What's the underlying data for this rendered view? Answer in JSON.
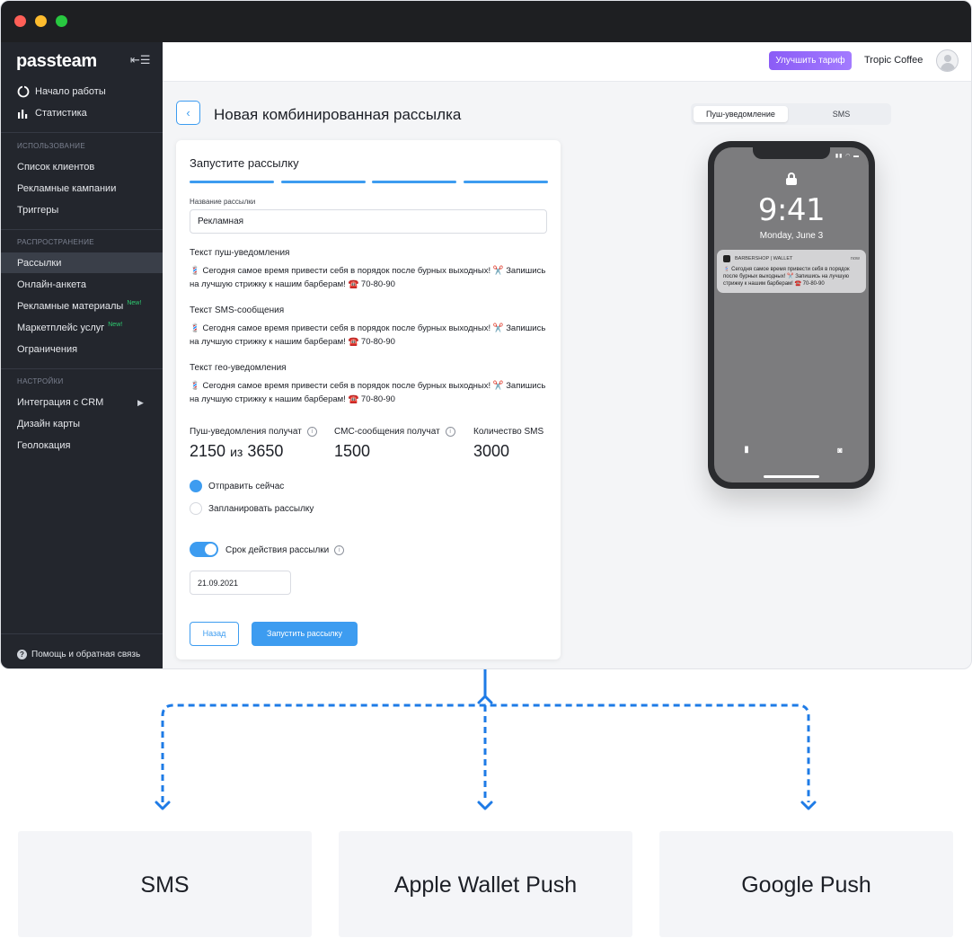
{
  "sidebar": {
    "logo": "passteam",
    "collapse_icon": "menu-collapse-icon",
    "top_items": [
      {
        "label": "Начало работы",
        "icon": "power-icon"
      },
      {
        "label": "Статистика",
        "icon": "bar-chart-icon"
      }
    ],
    "usage_section": "ИСПОЛЬЗОВАНИЕ",
    "usage_items": [
      "Список клиентов",
      "Рекламные кампании",
      "Триггеры"
    ],
    "distribution_section": "РАСПРОСТРАНЕНИЕ",
    "distribution_items": [
      {
        "label": "Рассылки",
        "active": true
      },
      {
        "label": "Онлайн-анкета"
      },
      {
        "label": "Рекламные материалы",
        "badge": "New!"
      },
      {
        "label": "Маркетплейс услуг",
        "badge": "New!"
      },
      {
        "label": "Ограничения"
      }
    ],
    "settings_section": "НАСТРОЙКИ",
    "settings_items": [
      "Интеграция с CRM",
      "Дизайн карты",
      "Геолокация"
    ],
    "help": "Помощь и обратная связь"
  },
  "topbar": {
    "upgrade_label": "Улучшить тариф",
    "company": "Tropic Coffee"
  },
  "page": {
    "title": "Новая комбинированная рассылка"
  },
  "form": {
    "card_title": "Запустите рассылку",
    "steps_total": 4,
    "name_label": "Название рассылки",
    "name_value": "Рекламная",
    "push_label": "Текст пуш-уведомления",
    "sms_label": "Текст SMS-сообщения",
    "geo_label": "Текст гео-уведомления",
    "message_text": "💈 Сегодня самое время привести себя в порядок после бурных выходных! ✂️ Запишись на лучшую стрижку к нашим барберам! ☎️ 70-80-90",
    "stats": {
      "push_label": "Пуш-уведомления получат",
      "push_value": "2150",
      "push_of": "из",
      "push_total": "3650",
      "sms_label": "СМС-сообщения получат",
      "sms_value": "1500",
      "count_label": "Количество SMS",
      "count_value": "3000"
    },
    "send_now": "Отправить сейчас",
    "schedule": "Запланировать рассылку",
    "validity_label": "Срок действия рассылки",
    "validity_date": "21.09.2021",
    "back_button": "Назад",
    "launch_button": "Запустить рассылку"
  },
  "preview": {
    "tabs": [
      "Пуш-уведомление",
      "SMS"
    ],
    "active_tab": "Пуш-уведомление",
    "time": "9:41",
    "date": "Monday, June 3",
    "notif_app": "BARBERSHOP | WALLET",
    "notif_time": "now",
    "notif_text": "💈 Сегодня самое время привести себя в порядок после бурных выходных! ✂️ Запишись на лучшую стрижку к нашим барберам! ☎️ 70-80-90"
  },
  "channels": [
    "SMS",
    "Apple Wallet Push",
    "Google Push"
  ],
  "colors": {
    "accent": "#3d9cf0",
    "sidebar_bg": "#23262d",
    "upgrade_gradient_start": "#8b5cf6",
    "connector": "#1e7be6"
  }
}
